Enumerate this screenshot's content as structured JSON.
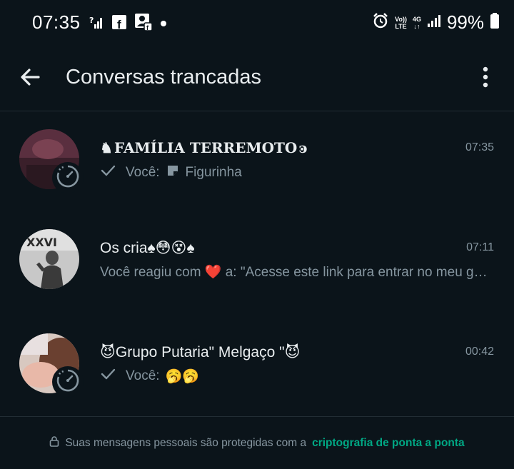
{
  "status_bar": {
    "time": "07:35",
    "left_icons": [
      "signal-question-icon",
      "facebook-icon",
      "profile-facebook-icon",
      "dot-icon"
    ],
    "right_icons": [
      "alarm-icon",
      "volte-icon",
      "4g-icon",
      "signal-icon",
      "battery-icon"
    ],
    "volte_label_top": "Vo))",
    "volte_label_bottom": "LTE",
    "net_label": "4G",
    "battery": "99%"
  },
  "app_bar": {
    "title": "Conversas trancadas",
    "back_icon": "arrow-left-icon",
    "menu_icon": "more-vertical-icon"
  },
  "chats": [
    {
      "name_prefix": "♞",
      "name": "FAMÍLIA TERREMOTO",
      "name_suffix": "ͽ",
      "time": "07:35",
      "preview_sender": "Você:",
      "preview_text": "Figurinha",
      "status_icon": "check-icon",
      "media_icon": "sticker-icon",
      "has_timer": true
    },
    {
      "name": "Os cria♠😳😵♠",
      "time": "07:11",
      "preview_text": "Você reagiu com ❤️ a: \"Acesse este link para entrar no meu grupo do WhatsApp\"",
      "has_timer": false
    },
    {
      "name": "😈Grupo Putaria\" Melgaço \"😈",
      "time": "00:42",
      "preview_sender": "Você:",
      "preview_text": "🥱🥱",
      "status_icon": "check-icon",
      "has_timer": true
    }
  ],
  "footer": {
    "text": "Suas mensagens pessoais são protegidas com a",
    "link": "criptografia de ponta a ponta",
    "icon": "lock-icon"
  },
  "colors": {
    "background": "#0b141a",
    "text_primary": "#e9edef",
    "text_secondary": "#8696a0",
    "accent": "#00a884",
    "divider": "#222d34"
  }
}
